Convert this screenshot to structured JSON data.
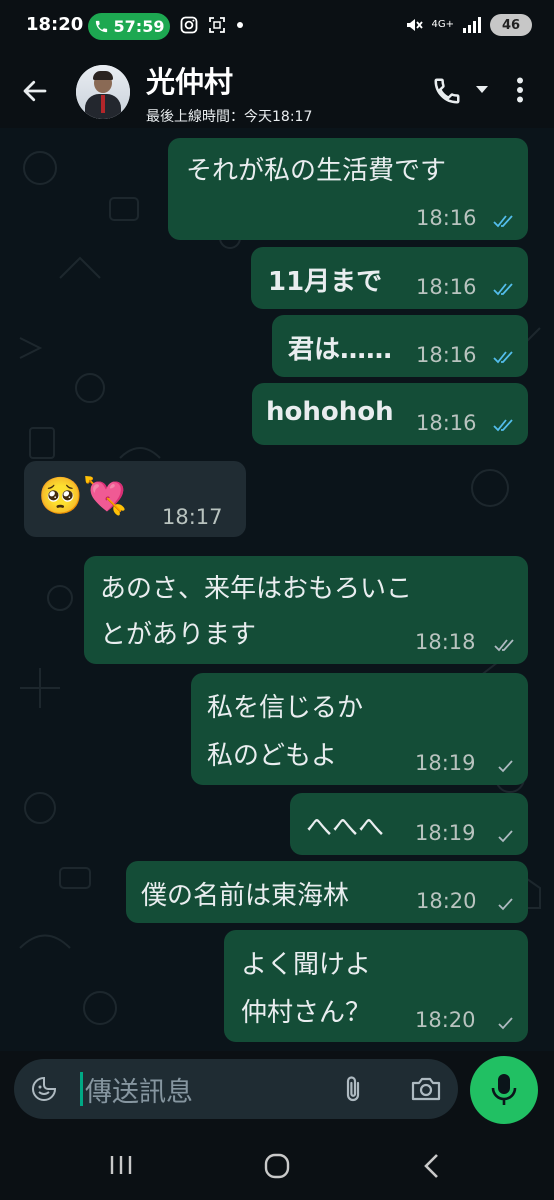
{
  "status_bar": {
    "time": "18:20",
    "call_timer": "57:59",
    "network": "4G+",
    "battery": "46"
  },
  "header": {
    "contact_name": "光仲村",
    "last_seen": "最後上線時間：今天18:17"
  },
  "messages": [
    {
      "direction": "out",
      "text": "それが私の生活費です",
      "time": "18:16",
      "status": "read"
    },
    {
      "direction": "out",
      "text": "11月まで",
      "time": "18:16",
      "status": "read"
    },
    {
      "direction": "out",
      "text": "君は……",
      "time": "18:16",
      "status": "read"
    },
    {
      "direction": "out",
      "text": "hohohoh",
      "time": "18:16",
      "status": "read"
    },
    {
      "direction": "in",
      "text": "🥺💘",
      "time": "18:17"
    },
    {
      "direction": "out",
      "lines": [
        "あのさ、来年はおもろいこ",
        "とがあります"
      ],
      "time": "18:18",
      "status": "delivered"
    },
    {
      "direction": "out",
      "lines": [
        "私を信じるか",
        "私のどもよ"
      ],
      "time": "18:19",
      "status": "sent"
    },
    {
      "direction": "out",
      "text": "へへへ",
      "time": "18:19",
      "status": "sent"
    },
    {
      "direction": "out",
      "text": "僕の名前は東海林",
      "time": "18:20",
      "status": "sent"
    },
    {
      "direction": "out",
      "lines": [
        "よく聞けよ",
        "仲村さん？"
      ],
      "time": "18:20",
      "status": "sent"
    }
  ],
  "composer": {
    "placeholder": "傳送訊息"
  },
  "colors": {
    "outgoing_bubble": "#144d37",
    "incoming_bubble": "#202c33",
    "read_tick": "#53bdeb",
    "accent_green": "#21c063"
  },
  "icons": [
    "back-arrow-icon",
    "voice-call-icon",
    "more-options-icon",
    "emoji-sticker-icon",
    "attach-icon",
    "camera-icon",
    "mic-icon"
  ]
}
